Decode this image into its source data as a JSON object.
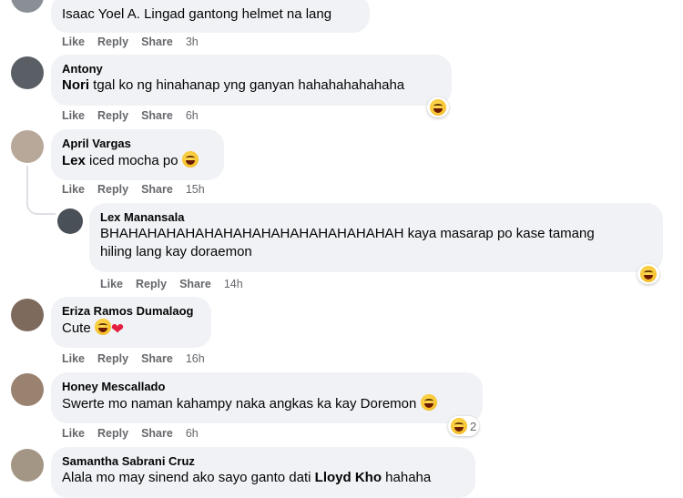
{
  "actions": {
    "like": "Like",
    "reply": "Reply",
    "share": "Share"
  },
  "comments": [
    {
      "author": "",
      "text": "Isaac Yoel A. Lingad gantong helmet na lang",
      "time": "3h"
    },
    {
      "author": "Antony",
      "mention": "Nori",
      "text": " tgal ko ng hinahanap yng ganyan hahahahahahaha",
      "time": "6h"
    },
    {
      "author": "April Vargas",
      "mention": "Lex",
      "text": " iced mocha po",
      "time": "15h"
    },
    {
      "author": "Lex Manansala",
      "text_line1": "BHAHAHAHAHAHAHAHAHAHAHAHAHAHAHAH kaya masarap po kase tamang",
      "text_line2": "hiling lang kay doraemon",
      "time": "14h"
    },
    {
      "author": "Eriza Ramos Dumalaog",
      "text": "Cute",
      "time": "16h"
    },
    {
      "author": "Honey Mescallado",
      "text": "Swerte mo naman kahampy naka angkas ka kay Doremon",
      "time": "6h",
      "reaction_count": "2"
    },
    {
      "author": "Samantha Sabrani Cruz",
      "text": "Alala mo may sinend ako sayo ganto dati ",
      "mention": "Lloyd Kho",
      "text_after": " hahaha"
    }
  ]
}
